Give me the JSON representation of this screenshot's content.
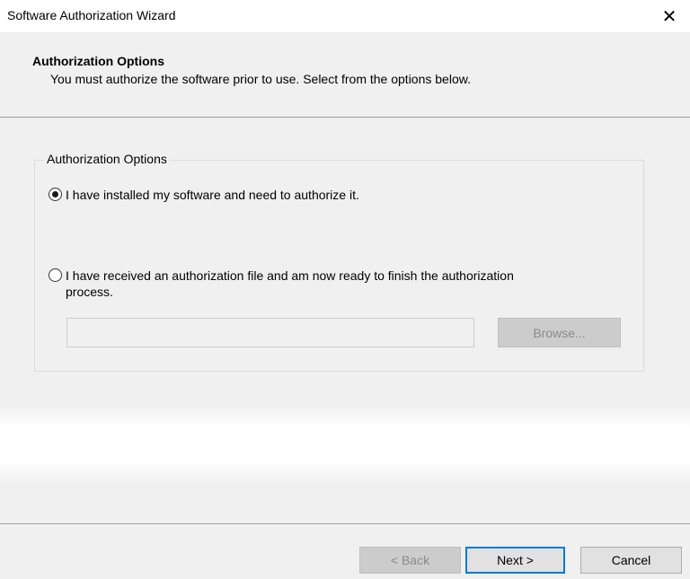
{
  "window": {
    "title": "Software Authorization Wizard",
    "close_glyph": "✕"
  },
  "header": {
    "title": "Authorization Options",
    "subtitle": "You must authorize the software prior to use. Select from the options below."
  },
  "group": {
    "legend": "Authorization Options",
    "options": [
      {
        "label": "I have installed my software and need to authorize it.",
        "selected": true
      },
      {
        "label_line1": "I have received an authorization file and am now ready to finish the authorization",
        "label_line2": "process.",
        "selected": false
      }
    ],
    "file_path": "",
    "browse_label": "Browse..."
  },
  "footer": {
    "back_label": "< Back",
    "next_label": "Next >",
    "cancel_label": "Cancel"
  },
  "colors": {
    "accent": "#0078d7",
    "disabled_bg": "#cccccc",
    "disabled_text": "#8a8a8a"
  }
}
